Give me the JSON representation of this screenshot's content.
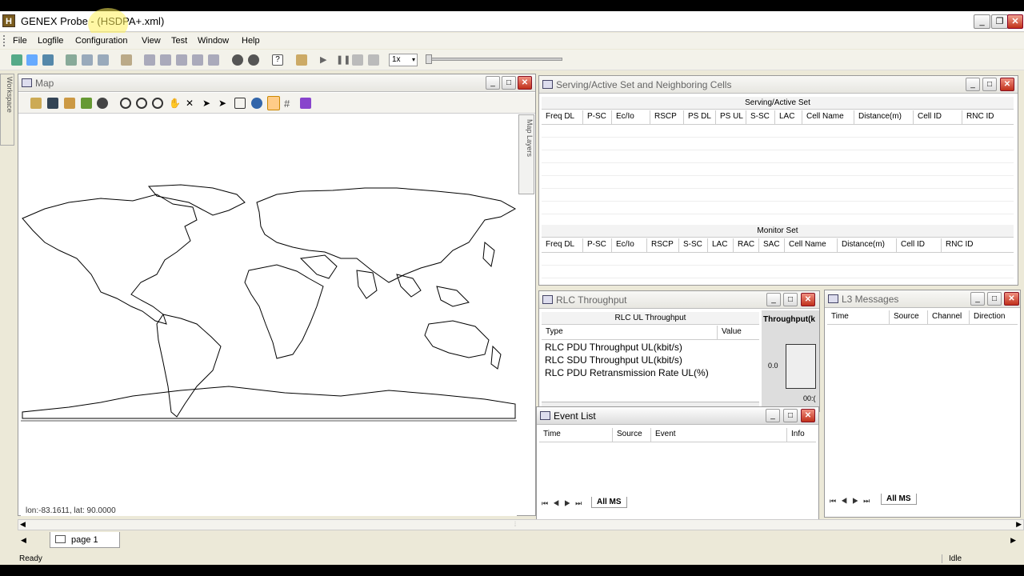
{
  "window": {
    "title": "GENEX Probe - (HSDPA+.xml)",
    "app_icon": "H"
  },
  "menu": [
    "File",
    "Logfile",
    "Configuration",
    "View",
    "Test",
    "Window",
    "Help"
  ],
  "toolbar": {
    "speed": "1x"
  },
  "workspace_label": "Workspace",
  "map_panel": {
    "title": "Map",
    "side_tab": "Map Layers",
    "coords": "lon:-83.1611, lat: 90.0000"
  },
  "serving_panel": {
    "title": "Serving/Active Set and Neighboring Cells",
    "section1": "Serving/Active Set",
    "cols1": [
      "Freq DL",
      "P-SC",
      "Ec/Io",
      "RSCP",
      "PS DL",
      "PS UL",
      "S-SC",
      "LAC",
      "Cell Name",
      "Distance(m)",
      "Cell ID",
      "RNC ID"
    ],
    "section2": "Monitor Set",
    "cols2": [
      "Freq DL",
      "P-SC",
      "Ec/Io",
      "RSCP",
      "S-SC",
      "LAC",
      "RAC",
      "SAC",
      "Cell Name",
      "Distance(m)",
      "Cell ID",
      "RNC ID"
    ]
  },
  "rlc_panel": {
    "title": "RLC Throughput",
    "section": "RLC UL Throughput",
    "col_type": "Type",
    "col_value": "Value",
    "rows": [
      "RLC PDU Throughput UL(kbit/s)",
      "RLC SDU Throughput UL(kbit/s)",
      "RLC PDU Retransmission Rate UL(%)"
    ],
    "chart_title": "Throughput(k",
    "chart_y": "0.0",
    "chart_x": "00:("
  },
  "l3_panel": {
    "title": "L3 Messages",
    "cols": [
      "Time",
      "Source",
      "Channel",
      "Direction"
    ],
    "tab": "All MS"
  },
  "event_panel": {
    "title": "Event List",
    "cols": [
      "Time",
      "Source",
      "Event",
      "Info"
    ],
    "tab": "All MS"
  },
  "page_tab": "page 1",
  "status": {
    "left": "Ready",
    "right": "Idle"
  }
}
